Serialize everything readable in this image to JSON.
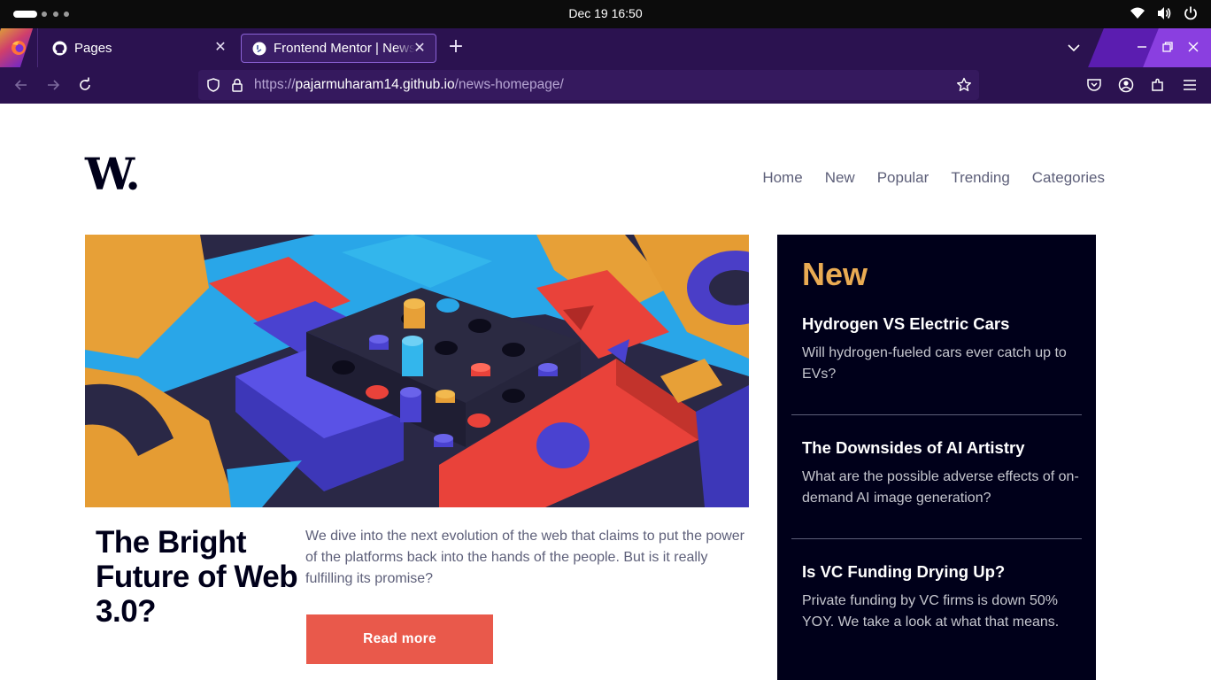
{
  "os": {
    "clock": "Dec 19  16:50",
    "tray": [
      "wifi-icon",
      "volume-icon",
      "power-icon"
    ]
  },
  "browser": {
    "tabs": [
      {
        "label": "Pages",
        "icon": "github-icon",
        "active": false
      },
      {
        "label": "Frontend Mentor | News homepage",
        "icon": "frontend-mentor-icon",
        "active": true
      }
    ],
    "url": {
      "scheme": "https://",
      "host": "pajarmuharam14.github.io",
      "path": "/news-homepage/"
    }
  },
  "site": {
    "logo": "W.",
    "nav": [
      "Home",
      "New",
      "Popular",
      "Trending",
      "Categories"
    ],
    "hero": {
      "title": "The Bright Future of Web 3.0?",
      "text": "We dive into the next evolution of the web that claims to put the power of the platforms back into the hands of the people. But is it really fulfilling its promise?",
      "button": "Read more"
    },
    "new_section": {
      "title": "New",
      "items": [
        {
          "title": "Hydrogen VS Electric Cars",
          "text": "Will hydrogen-fueled cars ever catch up to EVs?"
        },
        {
          "title": "The Downsides of AI Artistry",
          "text": "What are the possible adverse effects of on-demand AI image generation?"
        },
        {
          "title": "Is VC Funding Drying Up?",
          "text": "Private funding by VC firms is down 50% YOY. We take a look at what that means."
        }
      ]
    }
  },
  "colors": {
    "accent_red": "#e9594b",
    "accent_orange": "#e9ab53",
    "dark_navy": "#00001a",
    "text_grey": "#5d5f79",
    "browser_purple": "#2b1250"
  }
}
